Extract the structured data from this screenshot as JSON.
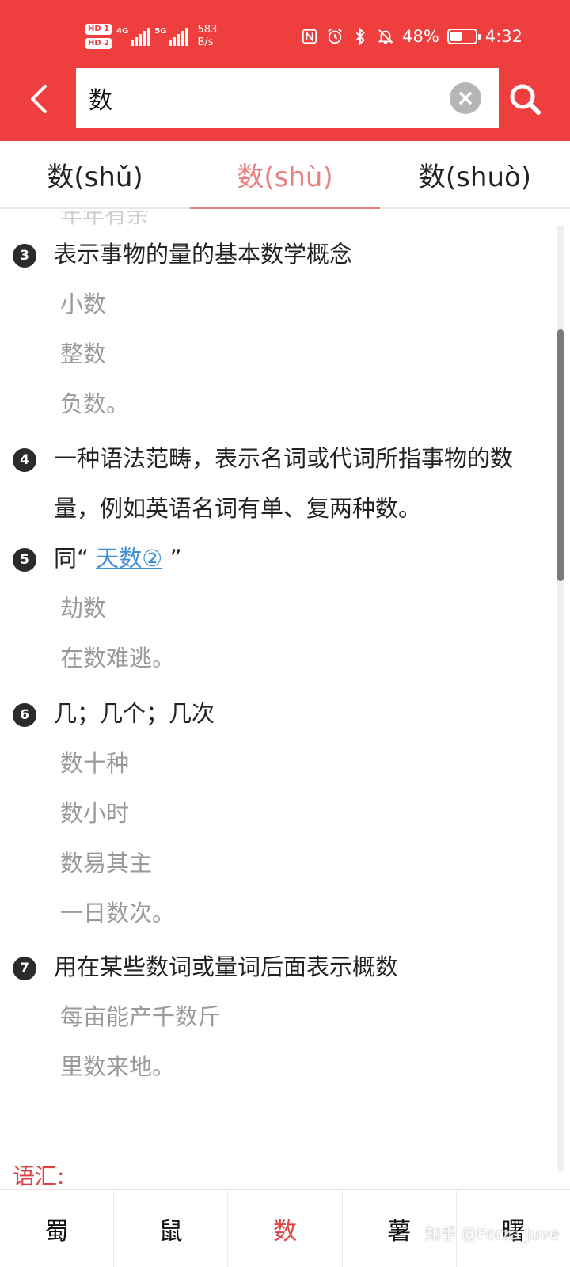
{
  "status_bar": {
    "hd1": "HD 1",
    "hd2": "HD 2",
    "sig1_label": "4G",
    "sig2_label": "5G",
    "speed_value": "583",
    "speed_unit": "B/s",
    "battery_text": "48%",
    "battery_level": 0.48,
    "time": "4:32"
  },
  "search": {
    "query": "数"
  },
  "tabs": [
    {
      "label": "数(shǔ)"
    },
    {
      "label": "数(shù)"
    },
    {
      "label": "数(shuò)"
    }
  ],
  "content": {
    "cut_text": "年年有余",
    "definitions": [
      {
        "num": "3",
        "text": "表示事物的量的基本数学概念",
        "examples": [
          "小数",
          "整数",
          "负数。"
        ]
      },
      {
        "num": "4",
        "text_line1": "一种语法范畴，表示名词或代词所指事物的数",
        "text_line2": "量，例如英语名词有单、复两种数。"
      },
      {
        "num": "5",
        "text_prefix": "同“ ",
        "link": "天数②",
        "text_suffix": " ”",
        "examples": [
          "劫数",
          "在数难逃。"
        ]
      },
      {
        "num": "6",
        "text": "几；几个；几次",
        "examples": [
          "数十种",
          "数小时",
          "数易其主",
          "一日数次。"
        ]
      },
      {
        "num": "7",
        "text": "用在某些数词或量词后面表示概数",
        "examples": [
          "每亩能产千数斤",
          "里数来地。"
        ]
      }
    ],
    "vocab_label": "语汇:"
  },
  "bottom_nav": [
    {
      "label": "蜀"
    },
    {
      "label": "鼠"
    },
    {
      "label": "数"
    },
    {
      "label": "薯"
    },
    {
      "label": "曙"
    }
  ],
  "watermark": "知乎 @Forza Juve",
  "colors": {
    "header_bg": "#ef3e3e",
    "tab_active": "#e98080",
    "link": "#3d8fd8",
    "accent_red": "#e04040"
  }
}
